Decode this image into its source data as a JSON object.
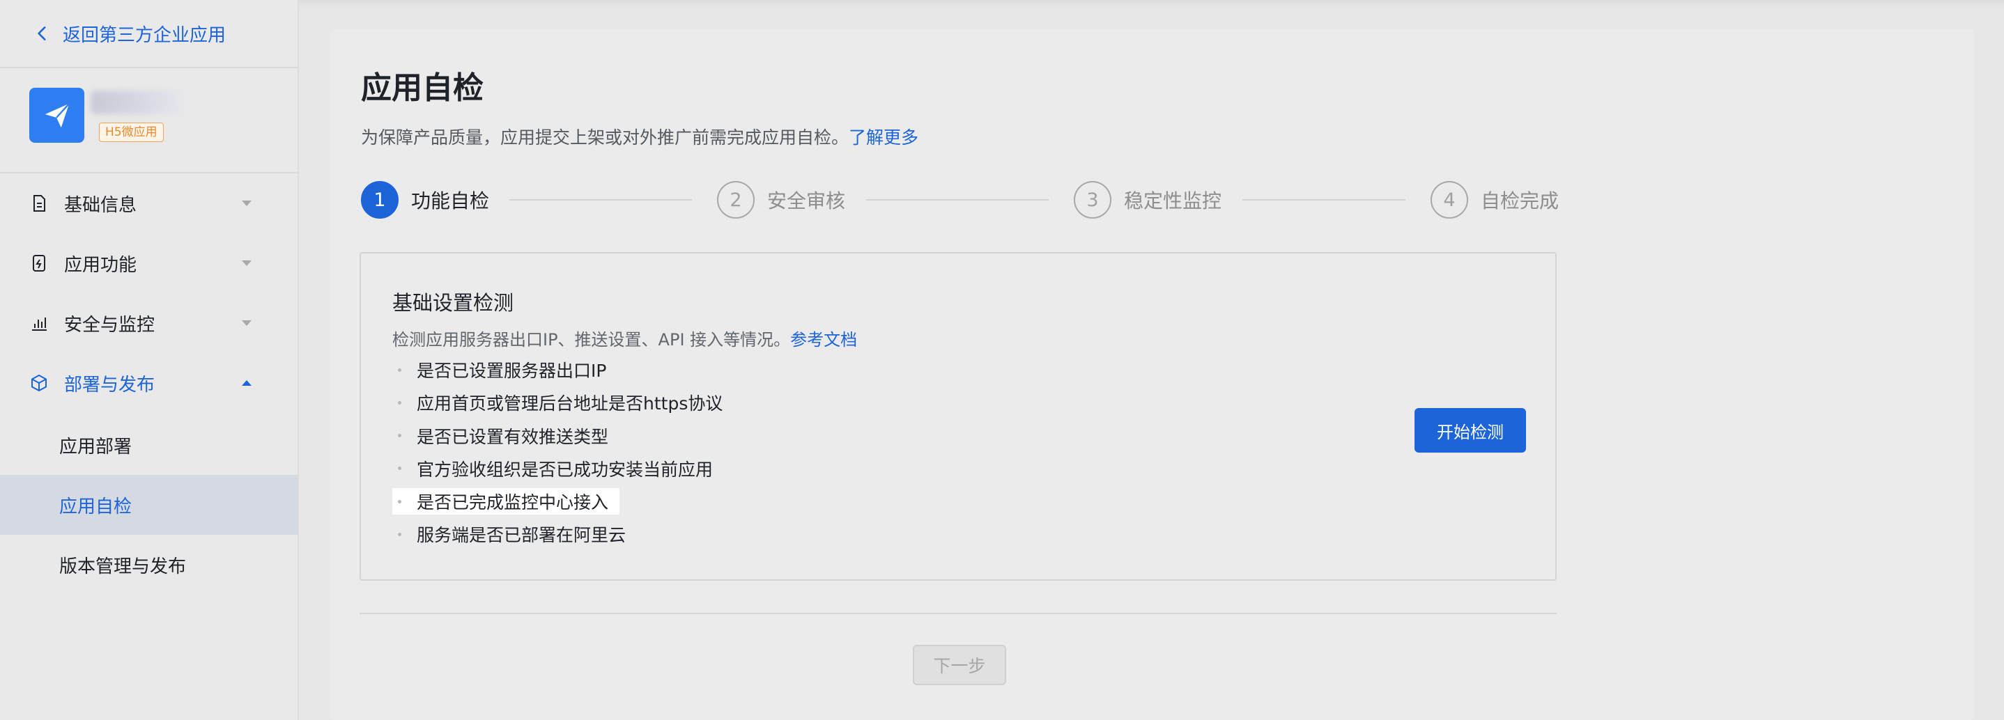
{
  "sidebar": {
    "back_label": "返回第三方企业应用",
    "app": {
      "name": "",
      "tag": "H5微应用"
    },
    "nav": [
      {
        "label": "基础信息",
        "icon": "document-icon",
        "expanded": false
      },
      {
        "label": "应用功能",
        "icon": "app-function-icon",
        "expanded": false
      },
      {
        "label": "安全与监控",
        "icon": "bar-chart-icon",
        "expanded": false
      },
      {
        "label": "部署与发布",
        "icon": "cube-icon",
        "expanded": true
      }
    ],
    "sub_items": [
      {
        "label": "应用部署",
        "selected": false
      },
      {
        "label": "应用自检",
        "selected": true
      },
      {
        "label": "版本管理与发布",
        "selected": false
      }
    ]
  },
  "main": {
    "title": "应用自检",
    "description": "为保障产品质量，应用提交上架或对外推广前需完成应用自检。",
    "learn_more": "了解更多",
    "steps": [
      {
        "number": "1",
        "label": "功能自检",
        "active": true
      },
      {
        "number": "2",
        "label": "安全审核",
        "active": false
      },
      {
        "number": "3",
        "label": "稳定性监控",
        "active": false
      },
      {
        "number": "4",
        "label": "自检完成",
        "active": false
      }
    ],
    "detect": {
      "title": "基础设置检测",
      "description": "检测应用服务器出口IP、推送设置、API 接入等情况。",
      "doc_link": "参考文档",
      "items": [
        "是否已设置服务器出口IP",
        "应用首页或管理后台地址是否https协议",
        "是否已设置有效推送类型",
        "官方验收组织是否已成功安装当前应用",
        "是否已完成监控中心接入",
        "服务端是否已部署在阿里云"
      ],
      "start_button": "开始检测"
    },
    "next_button": "下一步"
  },
  "colors": {
    "accent": "#1d64d8",
    "tag_orange": "#e68a2f",
    "background": "#e7e7e7"
  }
}
